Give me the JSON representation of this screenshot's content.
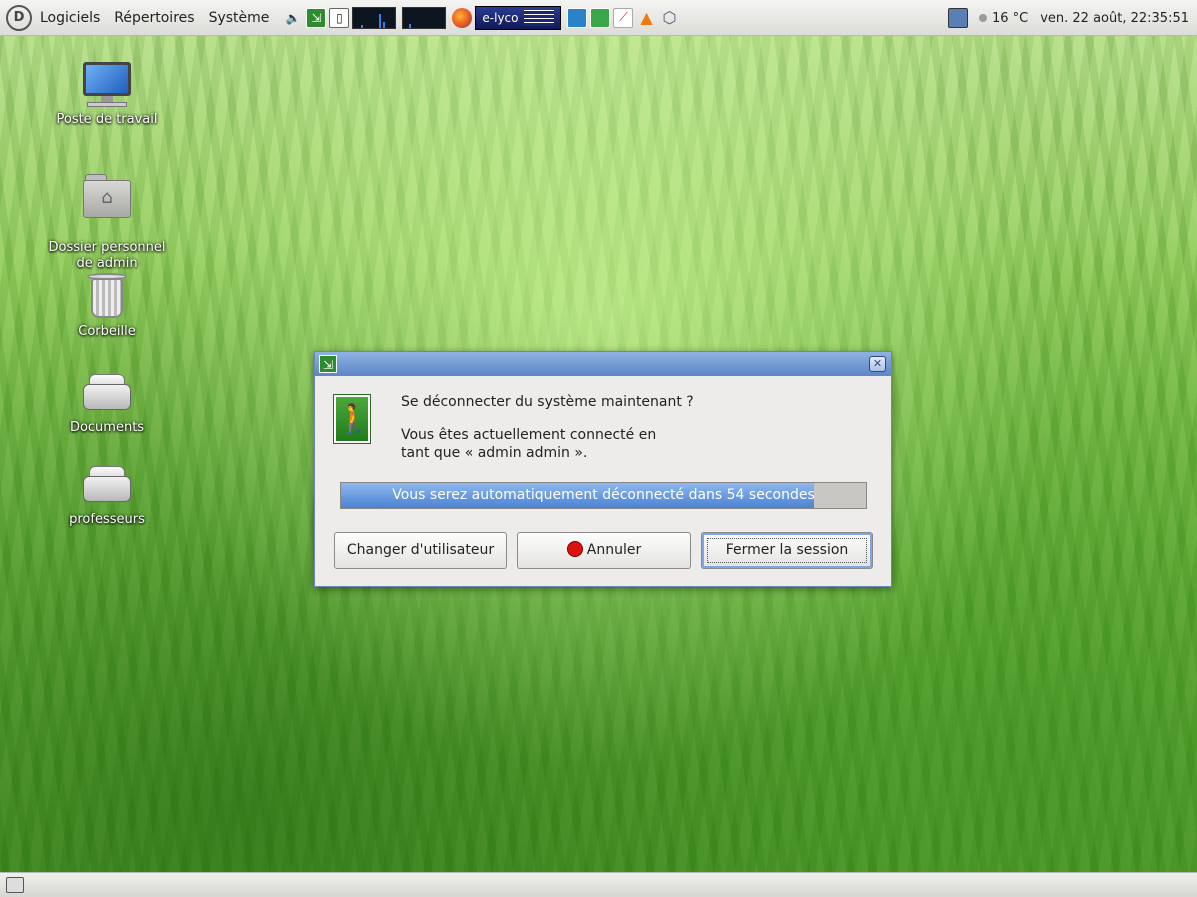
{
  "top_panel": {
    "menus": [
      "Logiciels",
      "Répertoires",
      "Système"
    ],
    "task_label": "e-lyco",
    "temperature": "16 °C",
    "clock": "ven. 22 août, 22:35:51"
  },
  "desktop": {
    "icons": [
      {
        "label": "Poste de travail",
        "icon": "computer-icon"
      },
      {
        "label": "Dossier personnel\nde admin",
        "icon": "home-folder-icon"
      },
      {
        "label": "Corbeille",
        "icon": "trash-icon"
      },
      {
        "label": "Documents",
        "icon": "drive-icon"
      },
      {
        "label": "professeurs",
        "icon": "drive-icon"
      }
    ]
  },
  "dialog": {
    "question": "Se déconnecter du système maintenant ?",
    "info_line1": "Vous êtes actuellement connecté en",
    "info_line2": "tant que « admin admin ».",
    "progress_text": "Vous serez automatiquement déconnecté dans 54 secondes",
    "progress_fraction": 0.9,
    "buttons": {
      "switch_user": "Changer d'utilisateur",
      "cancel": "Annuler",
      "logout": "Fermer la session"
    }
  },
  "colors": {
    "titlebar": "#5c86c6",
    "progress_fill": "#4a82d2",
    "exit_icon": "#2e8b2e"
  }
}
